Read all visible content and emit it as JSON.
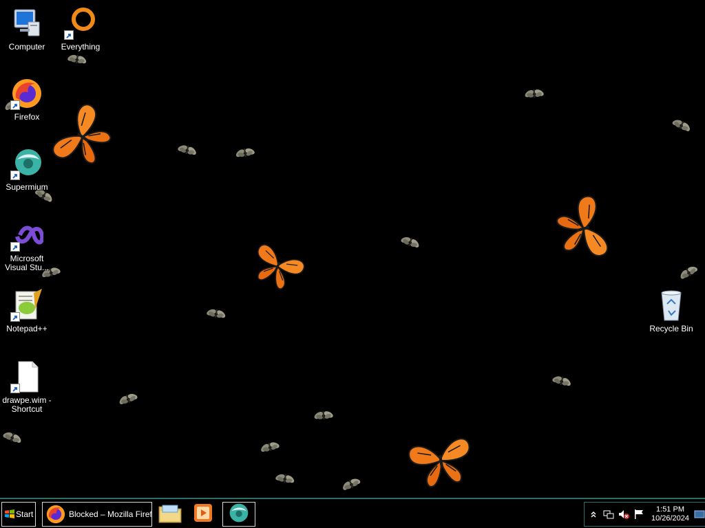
{
  "desktop": {
    "icons": [
      {
        "label": "Computer"
      },
      {
        "label": "Everything"
      },
      {
        "label": "Firefox"
      },
      {
        "label": "Supermium"
      },
      {
        "label": "Microsoft\nVisual Stu..."
      },
      {
        "label": "Notepad++"
      },
      {
        "label": "drawpe.wim -\nShortcut"
      },
      {
        "label": "Recycle Bin"
      }
    ]
  },
  "taskbar": {
    "start_label": "Start",
    "tasks": [
      {
        "label": "Blocked – Mozilla Firef..."
      }
    ],
    "clock": {
      "time": "1:51 PM",
      "date": "10/26/2024"
    }
  },
  "colors": {
    "desktop_bg": "#000000",
    "taskbar_bg": "#000000",
    "taskbar_accent": "#2f6f6a",
    "monarch_orange": "#f07a1a"
  },
  "icon_names": {
    "computer": "computer-icon",
    "everything": "everything-icon",
    "firefox": "firefox-icon",
    "supermium": "supermium-icon",
    "visual_studio": "visual-studio-icon",
    "notepadpp": "notepadpp-icon",
    "file": "file-icon",
    "recycle_bin": "recycle-bin-icon",
    "start": "windows-logo-icon",
    "explorer": "folder-icon",
    "media_player": "media-player-icon"
  }
}
